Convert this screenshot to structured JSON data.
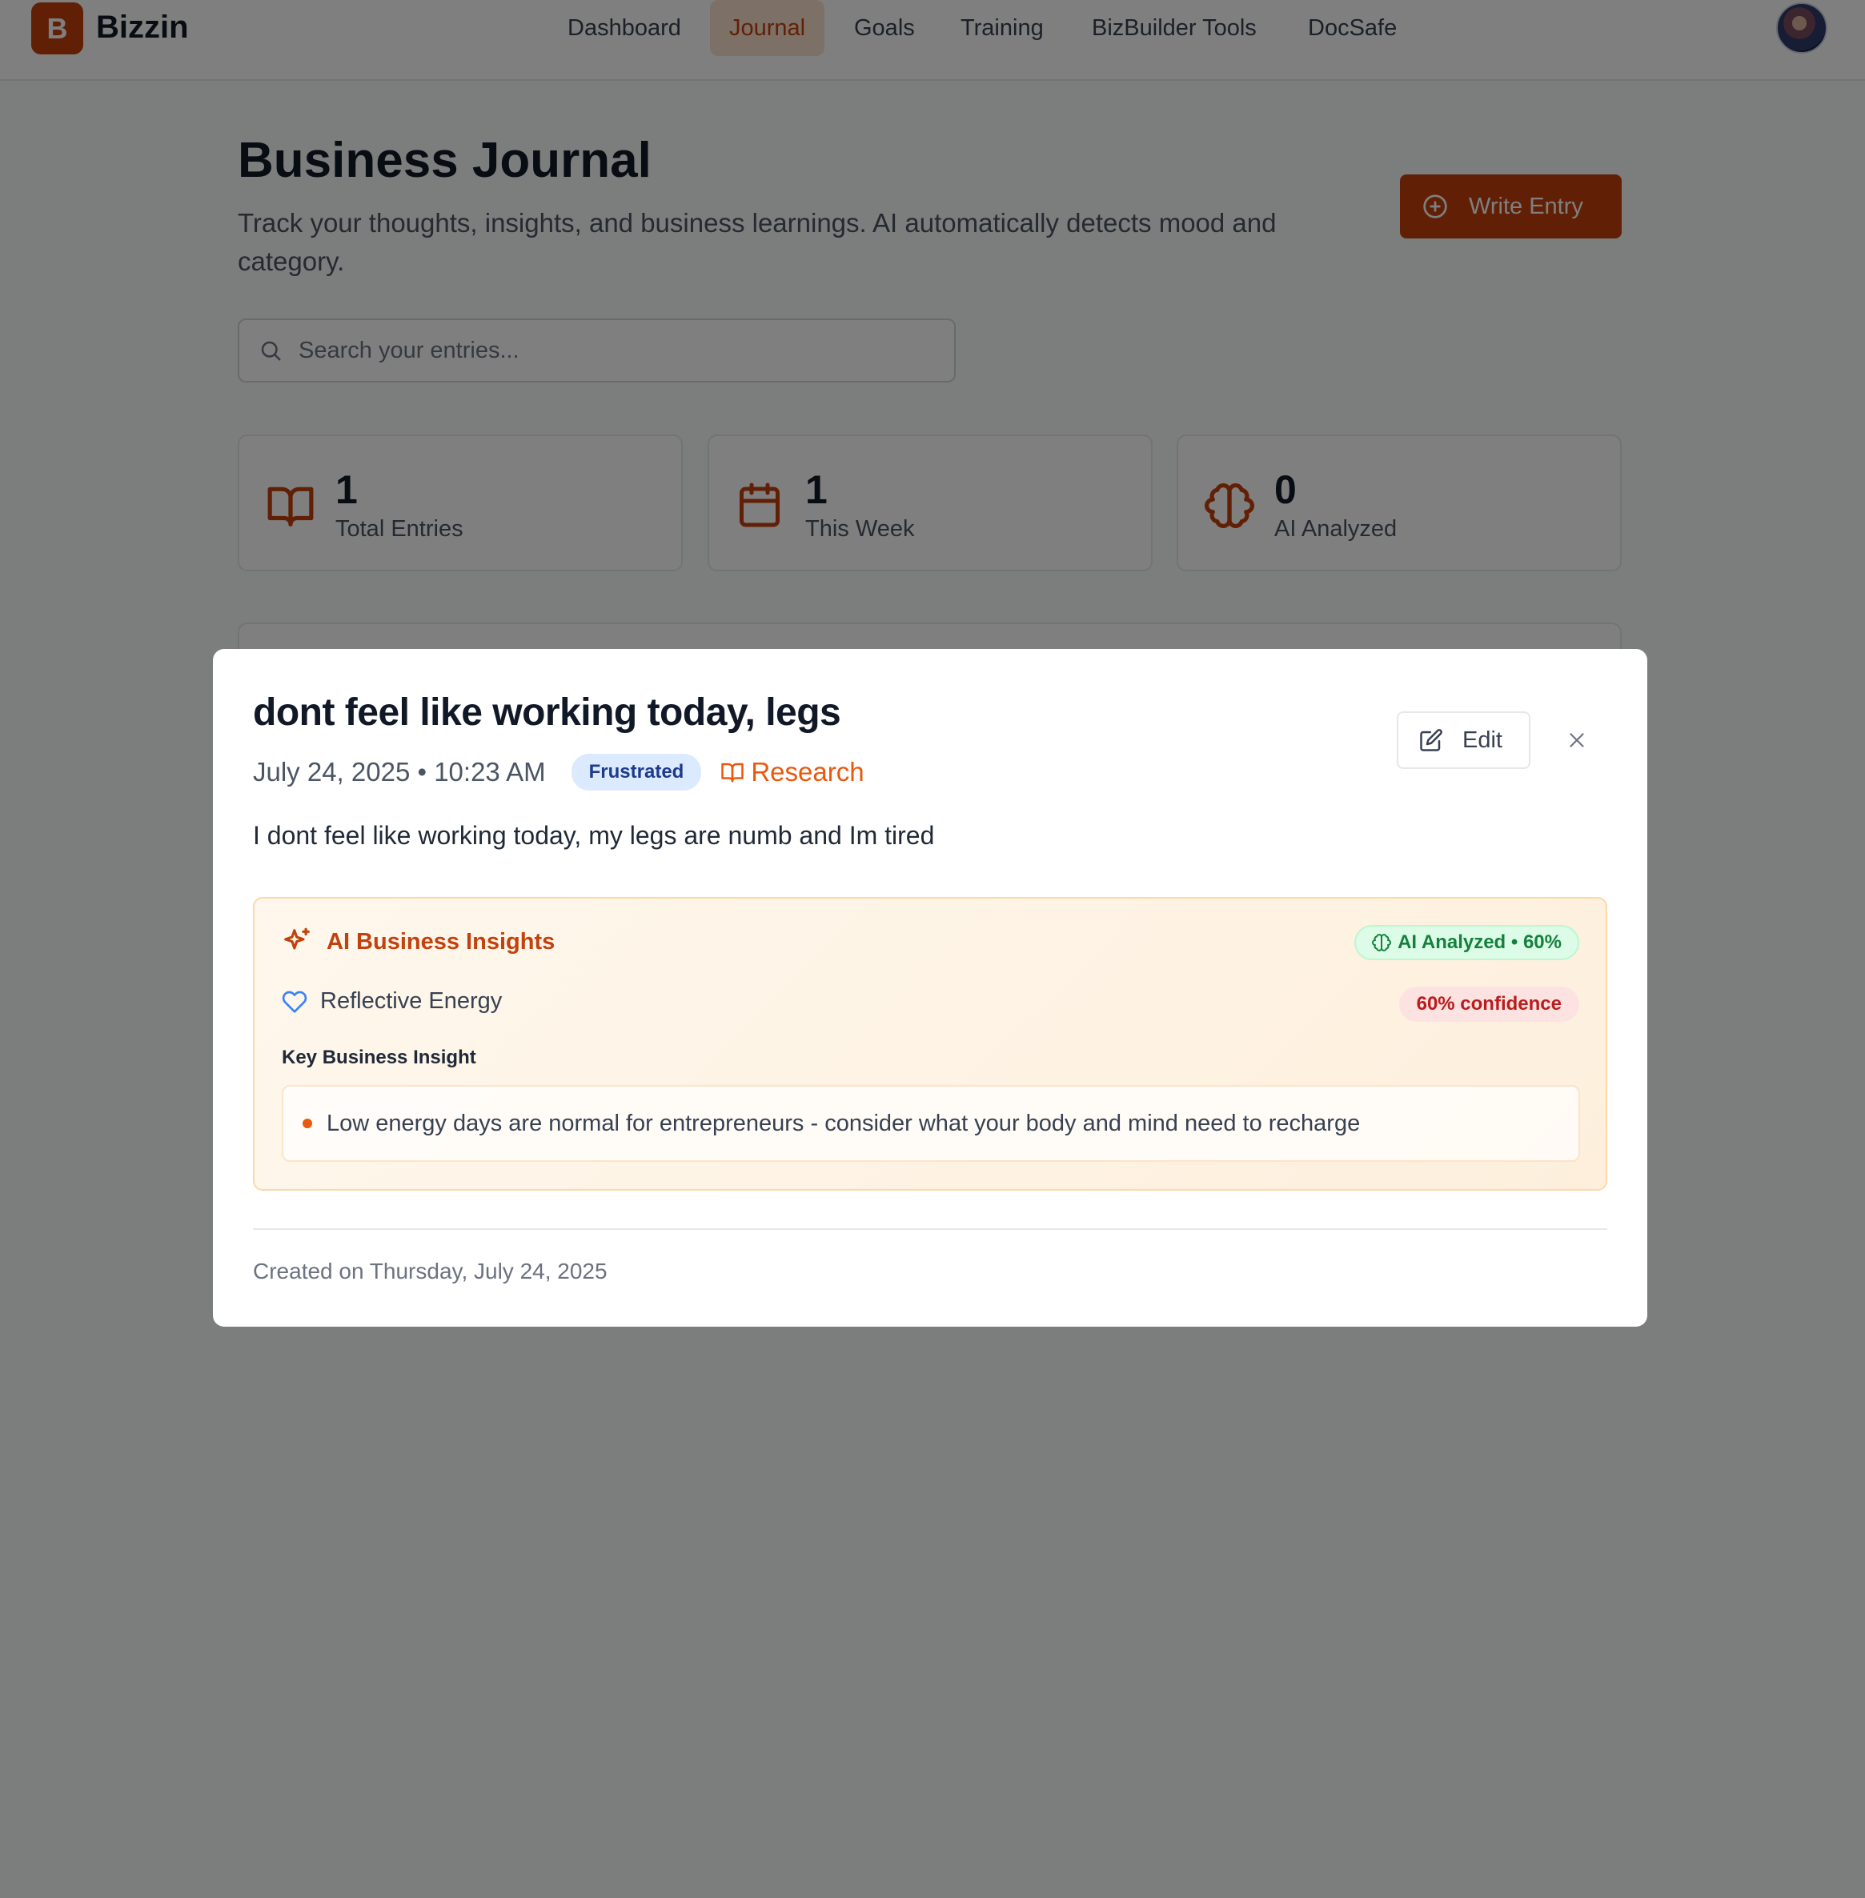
{
  "app": {
    "logo_letter": "B",
    "name": "Bizzin"
  },
  "nav": {
    "items": [
      {
        "label": "Dashboard",
        "active": false
      },
      {
        "label": "Journal",
        "active": true
      },
      {
        "label": "Goals",
        "active": false
      },
      {
        "label": "Training",
        "active": false
      },
      {
        "label": "BizBuilder Tools",
        "active": false
      },
      {
        "label": "DocSafe",
        "active": false
      }
    ]
  },
  "page": {
    "title": "Business Journal",
    "subtitle": "Track your thoughts, insights, and business learnings. AI automatically detects mood and category.",
    "write_button": "Write Entry",
    "search_placeholder": "Search your entries..."
  },
  "stats": [
    {
      "value": "1",
      "label": "Total Entries",
      "icon": "book-open-icon"
    },
    {
      "value": "1",
      "label": "This Week",
      "icon": "calendar-icon"
    },
    {
      "value": "0",
      "label": "AI Analyzed",
      "icon": "brain-icon"
    }
  ],
  "modal": {
    "title": "dont feel like working today, legs",
    "date": "July 24, 2025 • 10:23 AM",
    "mood": "Frustrated",
    "category": "Research",
    "edit_label": "Edit",
    "body": "I dont feel like working today, my legs are numb and Im tired",
    "insights": {
      "title": "AI Business Insights",
      "ai_badge": "AI Analyzed • 60%",
      "energy": "Reflective Energy",
      "confidence": "60% confidence",
      "key_label": "Key Business Insight",
      "key_insight": "Low energy days are normal for entrepreneurs - consider what your body and mind need to recharge"
    },
    "created": "Created on Thursday, July 24, 2025"
  },
  "colors": {
    "brand": "#c2410c",
    "accent_orange": "#ea580c",
    "mood_badge_bg": "#dbeafe",
    "ai_badge_bg": "#dcfce7",
    "confidence_bg": "#fde2e2"
  }
}
